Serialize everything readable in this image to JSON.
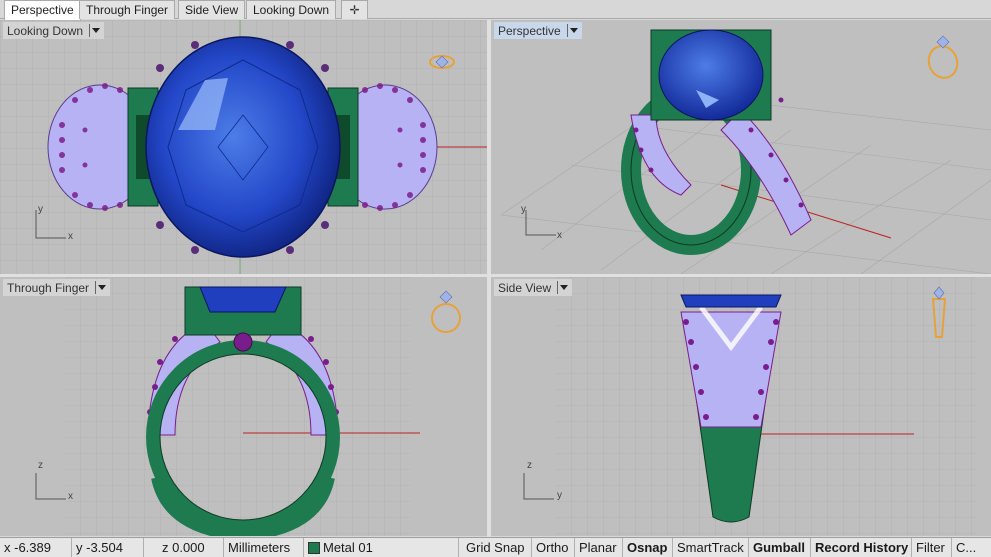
{
  "tabs": [
    "Perspective",
    "Through Finger",
    "Side View",
    "Looking Down"
  ],
  "add_tab_icon": "plus-icon",
  "viewports": {
    "top_left": {
      "label": "Looking Down",
      "axis1": "y",
      "axis2": "x"
    },
    "top_right": {
      "label": "Perspective",
      "axis1": "y",
      "axis2": "x"
    },
    "bottom_left": {
      "label": "Through Finger",
      "axis1": "z",
      "axis2": "x"
    },
    "bottom_right": {
      "label": "Side View",
      "axis1": "z",
      "axis2": "y"
    }
  },
  "status": {
    "x": "x -6.389",
    "y": "y -3.504",
    "z": "z 0.000",
    "units": "Millimeters",
    "layer": "Metal 01",
    "grid_snap": "Grid Snap",
    "ortho": "Ortho",
    "planar": "Planar",
    "osnap": "Osnap",
    "smarttrack": "SmartTrack",
    "gumball": "Gumball",
    "record_history": "Record History",
    "filter": "Filter",
    "more": "C..."
  },
  "colors": {
    "viewport_bg": "#bfbfbf",
    "grid": "#a9a9a9",
    "metal": "#1e7a4f",
    "gem": "#1f3fbf",
    "pave": "#b7b2f4",
    "prong": "#7a1d8c",
    "axis_red": "#b22",
    "gold_icon": "#e6a23a",
    "active_label": "#c8d8ea"
  }
}
